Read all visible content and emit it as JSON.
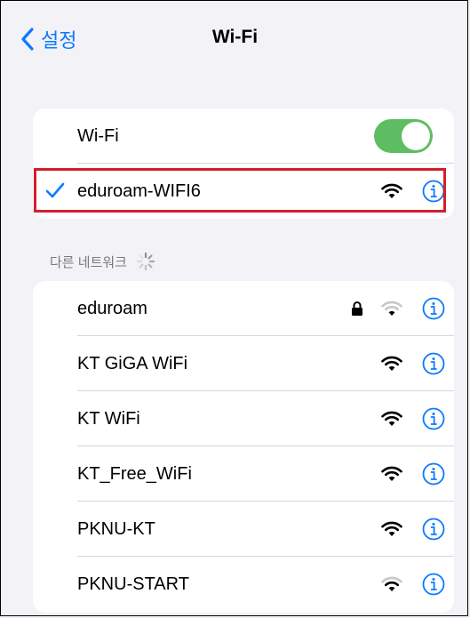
{
  "nav": {
    "back_label": "설정",
    "title": "Wi-Fi"
  },
  "wifi_toggle": {
    "label": "Wi-Fi",
    "on": true
  },
  "connected": {
    "name": "eduroam-WIFI6",
    "signal_icon": "wifi-full-icon",
    "info_icon": "info-icon",
    "highlight_color": "#d21f2a"
  },
  "other_networks": {
    "header": "다른 네트워크",
    "items": [
      {
        "name": "eduroam",
        "locked": true,
        "signal": "weak"
      },
      {
        "name": "KT GiGA WiFi",
        "locked": false,
        "signal": "full"
      },
      {
        "name": "KT WiFi",
        "locked": false,
        "signal": "full"
      },
      {
        "name": "KT_Free_WiFi",
        "locked": false,
        "signal": "full"
      },
      {
        "name": "PKNU-KT",
        "locked": false,
        "signal": "full"
      },
      {
        "name": "PKNU-START",
        "locked": false,
        "signal": "medium"
      }
    ]
  },
  "colors": {
    "accent": "#0a7aff",
    "toggle_on": "#5ebd63",
    "background": "#f2f2f7"
  }
}
